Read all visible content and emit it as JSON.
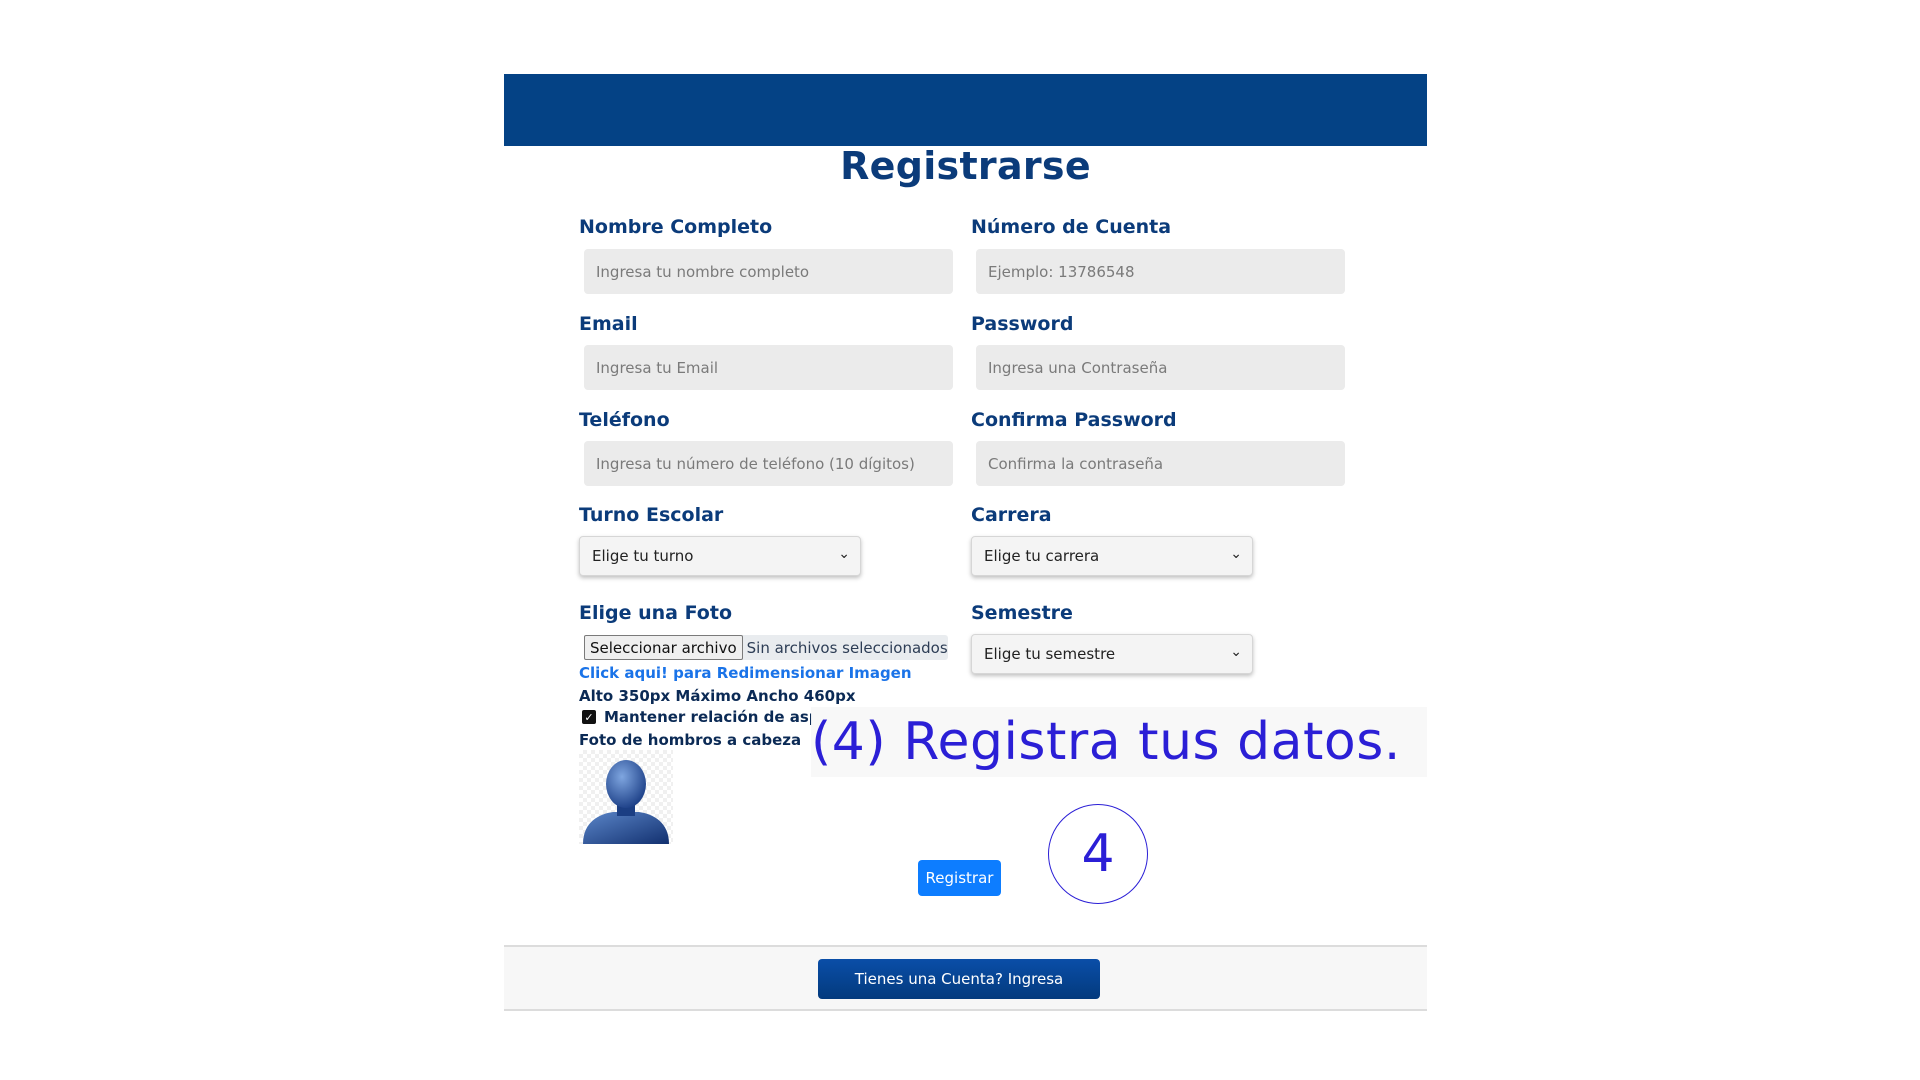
{
  "page": {
    "title": "Registrarse",
    "callout_text": "(4) Registra tus datos.",
    "step_number": "4"
  },
  "form": {
    "nombre": {
      "label": "Nombre Completo",
      "placeholder": "Ingresa tu nombre completo"
    },
    "cuenta": {
      "label": "Número de Cuenta",
      "placeholder": "Ejemplo: 13786548"
    },
    "email": {
      "label": "Email",
      "placeholder": "Ingresa tu Email"
    },
    "password": {
      "label": "Password",
      "placeholder": "Ingresa una Contraseña"
    },
    "telefono": {
      "label": "Teléfono",
      "placeholder": "Ingresa tu número de teléfono (10 dígitos)"
    },
    "confirm": {
      "label": "Confirma Password",
      "placeholder": "Confirma la contraseña"
    },
    "turno": {
      "label": "Turno Escolar",
      "selected": "Elige tu turno"
    },
    "carrera": {
      "label": "Carrera",
      "selected": "Elige tu carrera"
    },
    "semestre": {
      "label": "Semestre",
      "selected": "Elige tu semestre"
    },
    "foto": {
      "label": "Elige una Foto",
      "button_label": "Seleccionar archivo",
      "status": "Sin archivos seleccionados",
      "resize_link": "Click aqui! para Redimensionar Imagen",
      "size_note": "Alto 350px Máximo Ancho 460px",
      "aspect_checkbox_label": "Mantener relación de aspecto",
      "aspect_checked": true,
      "photo_hint": "Foto de hombros a cabeza"
    },
    "submit_label": "Registrar"
  },
  "footer": {
    "login_label": "Tienes una Cuenta? Ingresa"
  },
  "colors": {
    "brand_dark": "#044285",
    "label_color": "#0b3b7a",
    "primary_button": "#0d7dff",
    "annotation": "#2b1fd6"
  }
}
